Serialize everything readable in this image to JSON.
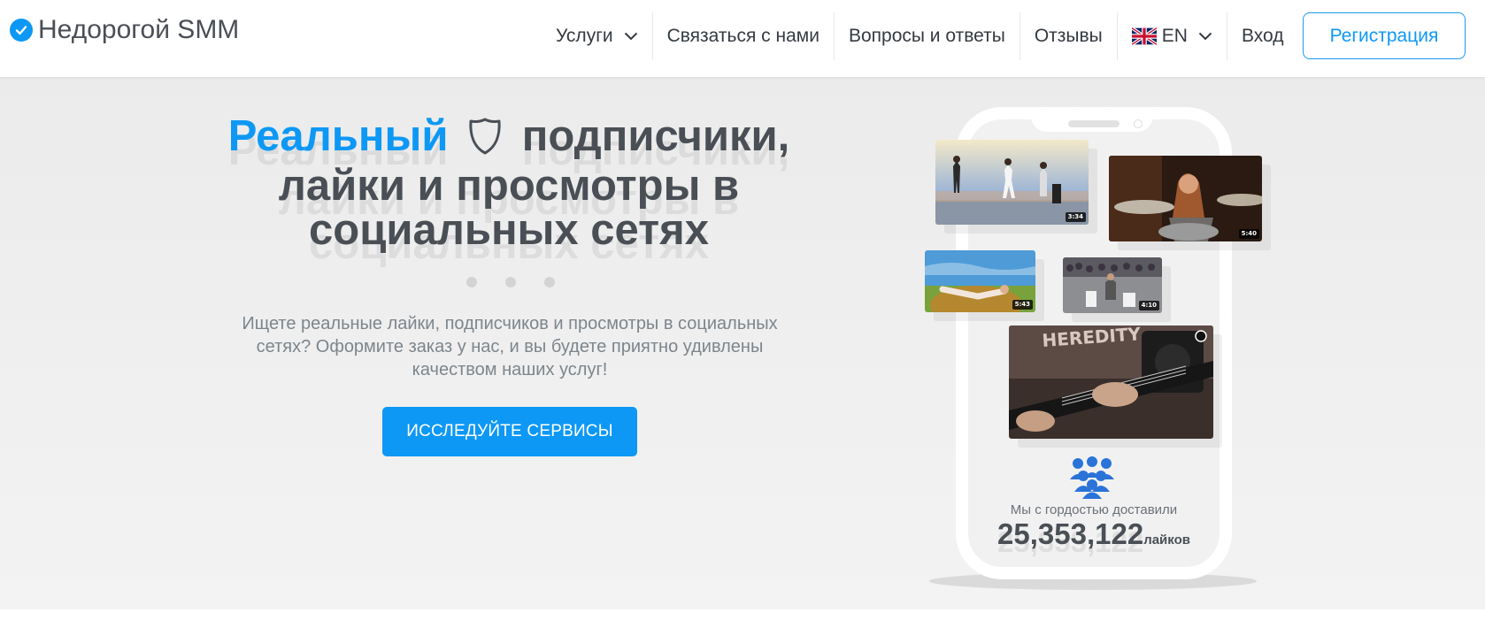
{
  "header": {
    "brand": "Недорогой SMM",
    "nav": {
      "services": "Услуги",
      "contact": "Связаться с нами",
      "faq": "Вопросы и ответы",
      "reviews": "Отзывы",
      "language": "EN",
      "login": "Вход"
    },
    "register": "Регистрация"
  },
  "hero": {
    "headline_accent": "Реальный",
    "headline_line1_rest": "подписчики,",
    "headline_line2": "лайки и просмотры в",
    "headline_line3": "социальных сетях",
    "description": "Ищете реальные лайки, подписчиков и просмотры в социальных сетях? Оформите заказ у нас, и вы будете приятно удивлены качеством наших услуг!",
    "cta": "ИССЛЕДУЙТЕ СЕРВИСЫ"
  },
  "phone": {
    "videos": [
      {
        "duration": "3:34"
      },
      {
        "duration": "5:40"
      },
      {
        "duration": "5:43"
      },
      {
        "duration": "4:10"
      },
      {
        "duration": ""
      }
    ],
    "stat_label": "Мы с гордостью доставили",
    "stat_value": "25,353,122",
    "stat_unit": "лайков"
  },
  "colors": {
    "accent": "#0e98f5",
    "text_dark": "#4a4f56",
    "hero_bg": "#efefef"
  },
  "icons": [
    "check-circle-icon",
    "chevron-down-icon",
    "uk-flag-icon",
    "shield-icon",
    "people-group-icon"
  ]
}
